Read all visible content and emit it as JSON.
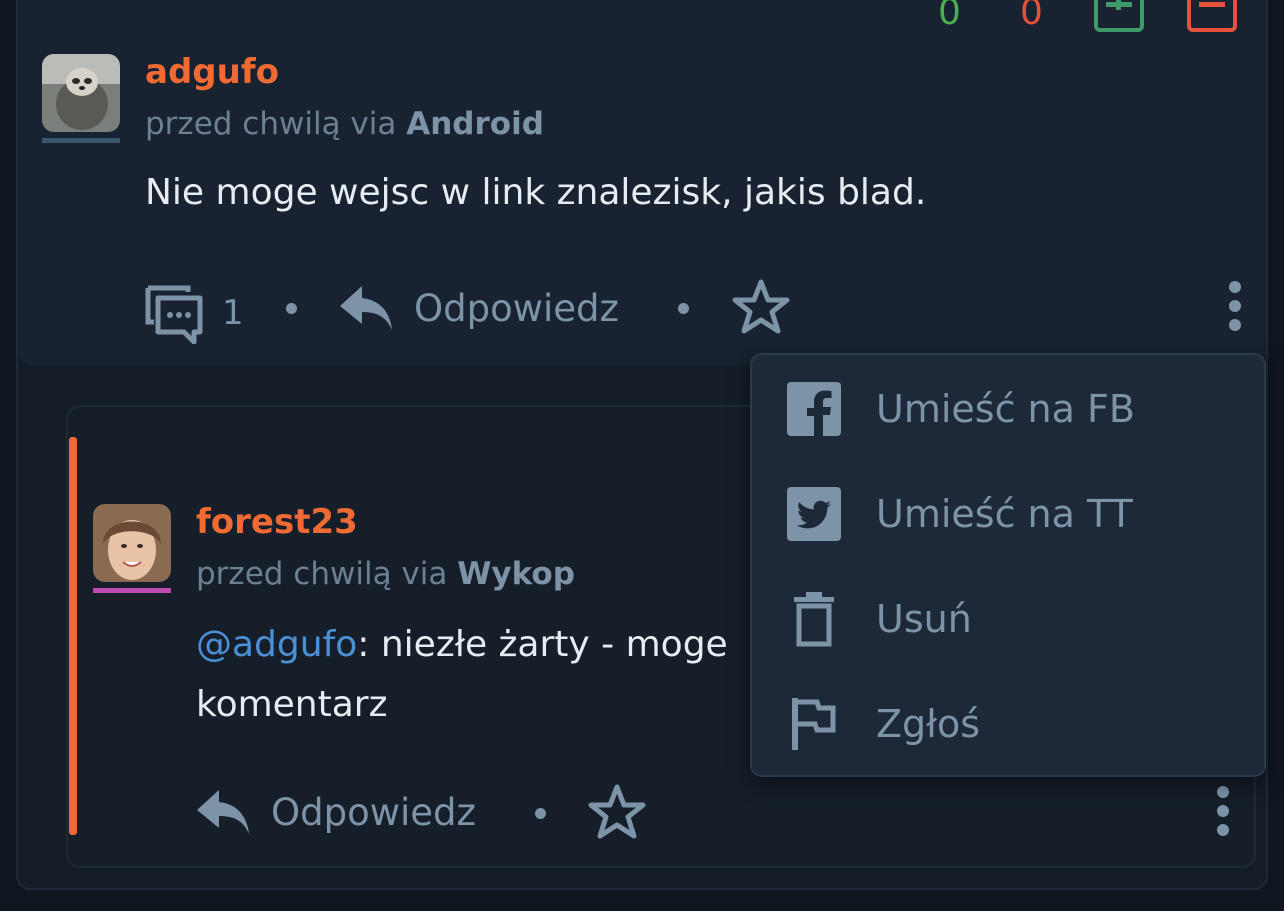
{
  "votes": {
    "up_count": "0",
    "down_count": "0"
  },
  "comment": {
    "username": "adgufo",
    "time_text": "przed chwilą via ",
    "source": "Android",
    "text": "Nie moge wejsc w link znalezisk, jakis blad.",
    "replies_count": "1",
    "reply_label": "Odpowiedz",
    "avatar_bar_color": "#3a5570"
  },
  "reply": {
    "username": "forest23",
    "time_text": "przed chwilą via ",
    "source": "Wykop",
    "mention": "@adgufo",
    "text_after_mention": ": niezłe żarty - moge",
    "text_line2": "komentarz",
    "reply_label": "Odpowiedz",
    "avatar_bar_color": "#c04bb0"
  },
  "menu": {
    "items": [
      {
        "label": "Umieść na FB",
        "icon": "facebook-icon"
      },
      {
        "label": "Umieść na TT",
        "icon": "twitter-icon"
      },
      {
        "label": "Usuń",
        "icon": "trash-icon"
      },
      {
        "label": "Zgłoś",
        "icon": "flag-icon"
      }
    ]
  },
  "colors": {
    "accent": "#f06a33",
    "vote_up": "#4caf50",
    "vote_down": "#e5533d",
    "mention": "#4a90d6"
  }
}
